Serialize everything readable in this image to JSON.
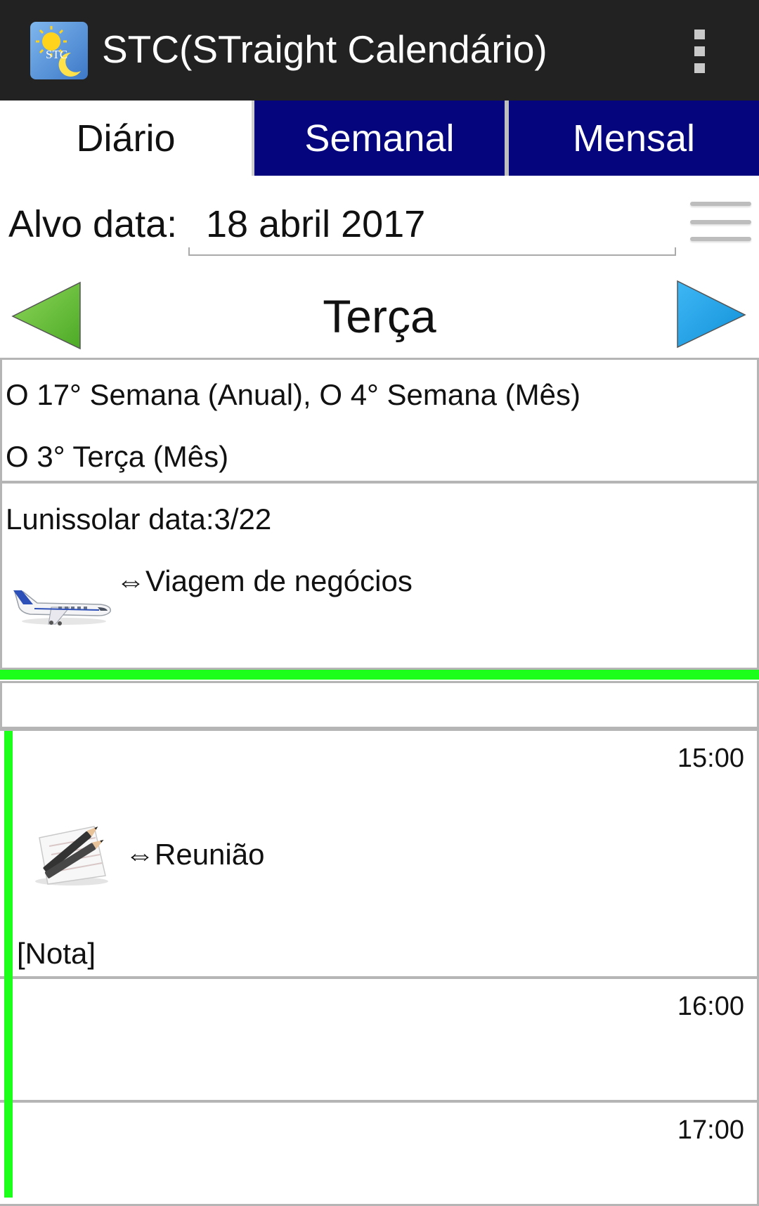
{
  "app": {
    "title": "STC(STraight Calendário)",
    "icon_text": "STC",
    "icon": "sun-moon-app-icon",
    "menu_icon": "overflow-menu-icon"
  },
  "tabs": [
    {
      "label": "Diário",
      "active": true
    },
    {
      "label": "Semanal",
      "active": false
    },
    {
      "label": "Mensal",
      "active": false
    }
  ],
  "target": {
    "label": "Alvo data:",
    "date": "18 abril 2017",
    "menu_icon": "hamburger-icon"
  },
  "day_nav": {
    "prev_icon": "triangle-left-green-icon",
    "weekday": "Terça",
    "next_icon": "triangle-right-blue-icon"
  },
  "week_info": {
    "line1": "O 17° Semana (Anual), O 4° Semana (Mês)",
    "line2": "O 3° Terça (Mês)"
  },
  "lunar": {
    "text": "Lunissolar data:3/22",
    "event_icon": "airplane-icon",
    "event": "⇔Viagem de negócios"
  },
  "schedule": [
    {
      "time": "15:00",
      "event_icon": "pencil-note-icon",
      "event": "⇔Reunião",
      "note": "[Nota]"
    },
    {
      "time": "16:00"
    },
    {
      "time": "17:00"
    }
  ],
  "colors": {
    "app_bar": "#222222",
    "tab_inactive": "#05057e",
    "highlight_green": "#1bff1b",
    "border": "#b5b5b5"
  }
}
